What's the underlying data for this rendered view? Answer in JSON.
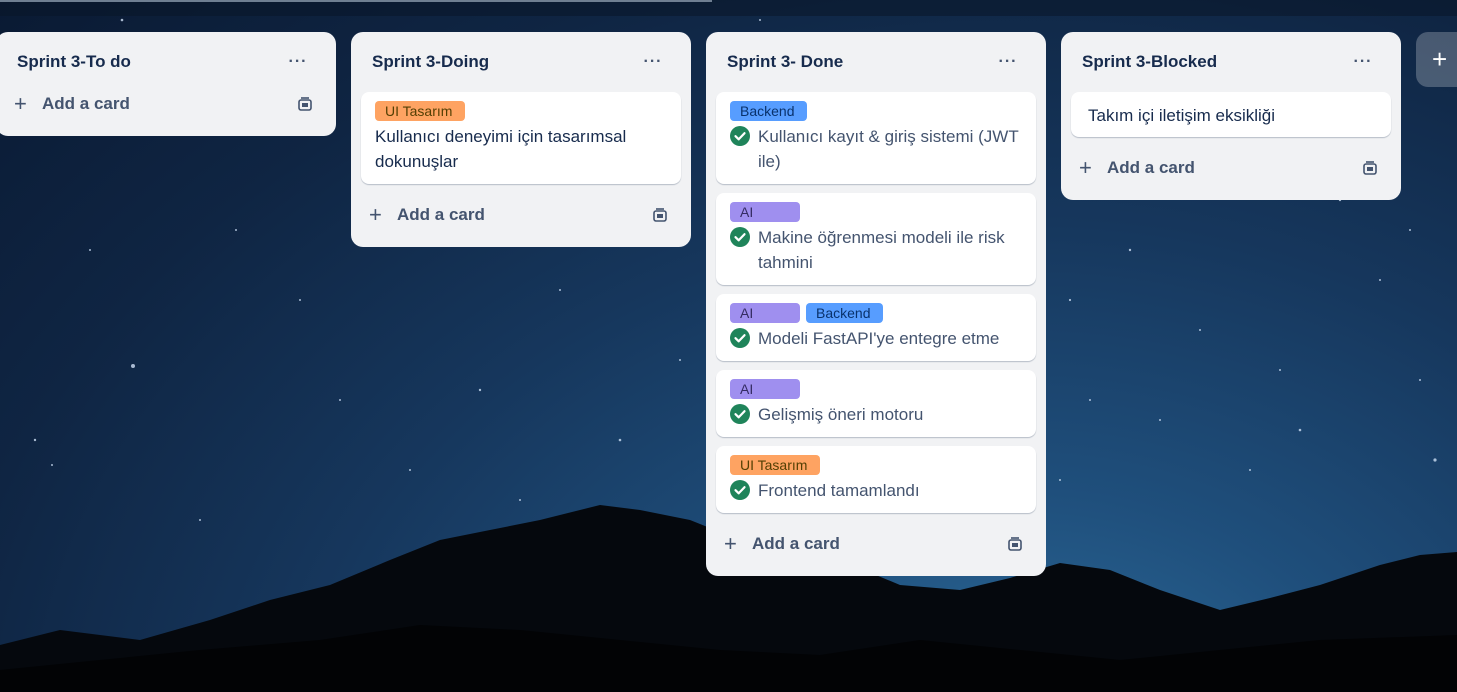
{
  "colors": {
    "label_ui": "#fea362",
    "label_backend": "#579dff",
    "label_ai": "#9f8fef",
    "check_green": "#1f845a",
    "list_bg": "#f1f2f4"
  },
  "add_list_glyph": "+",
  "lists": [
    {
      "title": "Sprint 3-To do",
      "menu": "···",
      "add_label": "Add a card",
      "cards": []
    },
    {
      "title": "Sprint 3-Doing",
      "menu": "···",
      "add_label": "Add a card",
      "cards": [
        {
          "labels": [
            "UI Tasarım"
          ],
          "title": "Kullanıcı deneyimi için tasarımsal dokunuşlar",
          "done": false
        }
      ]
    },
    {
      "title": "Sprint 3- Done",
      "menu": "···",
      "add_label": "Add a card",
      "cards": [
        {
          "labels": [
            "Backend"
          ],
          "title": "Kullanıcı kayıt & giriş sistemi (JWT ile)",
          "done": true
        },
        {
          "labels": [
            "AI"
          ],
          "title": "Makine öğrenmesi modeli ile risk tahmini",
          "done": true
        },
        {
          "labels": [
            "AI",
            "Backend"
          ],
          "title": "Modeli FastAPI'ye entegre etme",
          "done": true
        },
        {
          "labels": [
            "AI"
          ],
          "title": "Gelişmiş öneri motoru",
          "done": true
        },
        {
          "labels": [
            "UI Tasarım"
          ],
          "title": "Frontend tamamlandı",
          "done": true
        }
      ]
    },
    {
      "title": "Sprint 3-Blocked",
      "menu": "···",
      "add_label": "Add a card",
      "cards": [
        {
          "labels": [],
          "title": "Takım içi iletişim eksikliği",
          "done": false
        }
      ]
    }
  ]
}
